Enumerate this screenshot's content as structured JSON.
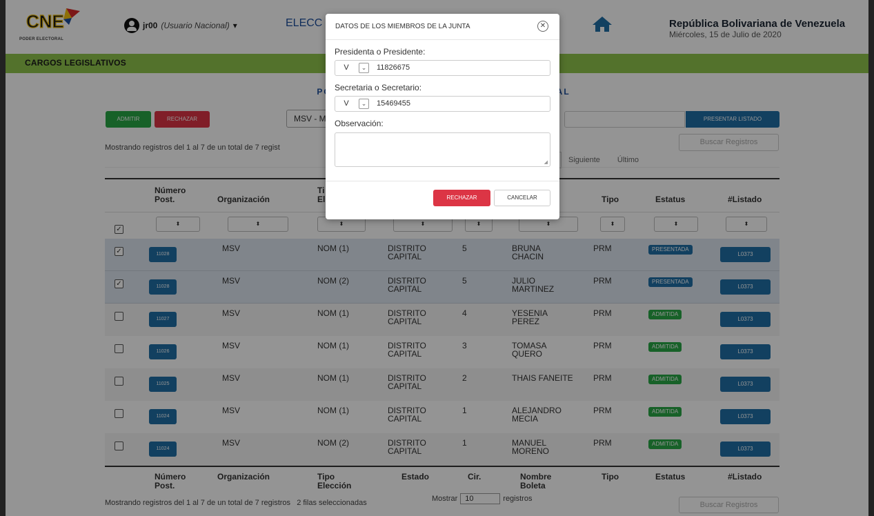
{
  "header": {
    "logo_text": "CNE",
    "logo_sub": "PODER ELECTORAL",
    "user_name": "jr00",
    "user_role": "(Usuario Nacional)",
    "user_caret": "▾",
    "elections_label": "ELECC",
    "home_icon": "home-icon",
    "republic": "República Bolivariana de Venezuela",
    "date": "Miércoles, 15 de Julio de 2020"
  },
  "section": {
    "title": "CARGOS LEGISLATIVOS"
  },
  "panel": {
    "title": "POSTULA                                            CTORAL",
    "admit_label": "ADMITIR",
    "reject_label": "RECHAZAR",
    "org_select": "MSV - M",
    "present_label": "PRESENTAR LISTADO",
    "showing": "Mostrando registros del 1 al 7 de un total de 7 regist",
    "search_placeholder": "Buscar Registros",
    "pager": {
      "next": "Siguiente",
      "last": "Último"
    }
  },
  "table": {
    "headers": {
      "num": "Número Post.",
      "org": "Organización",
      "tipo_eleccion": "Ti El",
      "tipo": "Tipo",
      "estatus": "Estatus",
      "listado": "#Listado"
    },
    "filter_symbol": "⬍",
    "rows": [
      {
        "checked": true,
        "selected": true,
        "num": "11028",
        "org": "MSV",
        "te": "NOM (1)",
        "estado": "DISTRITO CAPITAL",
        "cir": "5",
        "nombre": "BRUNA CHACIN",
        "tipo": "PRM",
        "estatus": "PRESENTADA",
        "status_kind": "p",
        "listado": "L0373"
      },
      {
        "checked": true,
        "selected": true,
        "num": "11028",
        "org": "MSV",
        "te": "NOM (2)",
        "estado": "DISTRITO CAPITAL",
        "cir": "5",
        "nombre": "JULIO MARTINEZ",
        "tipo": "PRM",
        "estatus": "PRESENTADA",
        "status_kind": "p",
        "listado": "L0373"
      },
      {
        "checked": false,
        "selected": false,
        "num": "11027",
        "org": "MSV",
        "te": "NOM (1)",
        "estado": "DISTRITO CAPITAL",
        "cir": "4",
        "nombre": "YESENIA PEREZ",
        "tipo": "PRM",
        "estatus": "ADMITIDA",
        "status_kind": "a",
        "listado": "L0373"
      },
      {
        "checked": false,
        "selected": false,
        "num": "11026",
        "org": "MSV",
        "te": "NOM (1)",
        "estado": "DISTRITO CAPITAL",
        "cir": "3",
        "nombre": "TOMASA QUERO",
        "tipo": "PRM",
        "estatus": "ADMITIDA",
        "status_kind": "a",
        "listado": "L0373"
      },
      {
        "checked": false,
        "selected": false,
        "num": "11025",
        "org": "MSV",
        "te": "NOM (1)",
        "estado": "DISTRITO CAPITAL",
        "cir": "2",
        "nombre": "THAIS FANEITE",
        "tipo": "PRM",
        "estatus": "ADMITIDA",
        "status_kind": "a",
        "listado": "L0373"
      },
      {
        "checked": false,
        "selected": false,
        "num": "11024",
        "org": "MSV",
        "te": "NOM (1)",
        "estado": "DISTRITO CAPITAL",
        "cir": "1",
        "nombre": "ALEJANDRO MECIA",
        "tipo": "PRM",
        "estatus": "ADMITIDA",
        "status_kind": "a",
        "listado": "L0373"
      },
      {
        "checked": false,
        "selected": false,
        "num": "11024",
        "org": "MSV",
        "te": "NOM (2)",
        "estado": "DISTRITO CAPITAL",
        "cir": "1",
        "nombre": "MANUEL MORENO",
        "tipo": "PRM",
        "estatus": "ADMITIDA",
        "status_kind": "a",
        "listado": "L0373"
      }
    ],
    "footer": {
      "num": "Número Post.",
      "org": "Organización",
      "tipo_eleccion": "Tipo Elección",
      "estado": "Estado",
      "cir": "Cir.",
      "nombre": "Nombre Boleta",
      "tipo": "Tipo",
      "estatus": "Estatus",
      "listado": "#Listado"
    }
  },
  "bottom": {
    "status": "Mostrando registros del 1 al 7 de un total de 7 registros   2 filas seleccionadas",
    "mostrar": "Mostrar",
    "page_size": "10",
    "registros": "registros",
    "search_placeholder": "Buscar Registros"
  },
  "modal": {
    "title": "DATOS DE LOS MIEMBROS DE LA JUNTA",
    "close_icon": "close-icon",
    "president_label": "Presidenta o Presidente:",
    "president_doc_type": "V",
    "president_id": "11826675",
    "secretary_label": "Secretaria o Secretario:",
    "secretary_doc_type": "V",
    "secretary_id": "15469455",
    "observation_label": "Observación:",
    "observation_value": "",
    "reject_label": "RECHAZAR",
    "cancel_label": "CANCELAR"
  },
  "colors": {
    "green_bar": "#8fc44d",
    "primary_blue": "#1f6fa6",
    "danger_red": "#dc3545",
    "success_green": "#28a745"
  }
}
